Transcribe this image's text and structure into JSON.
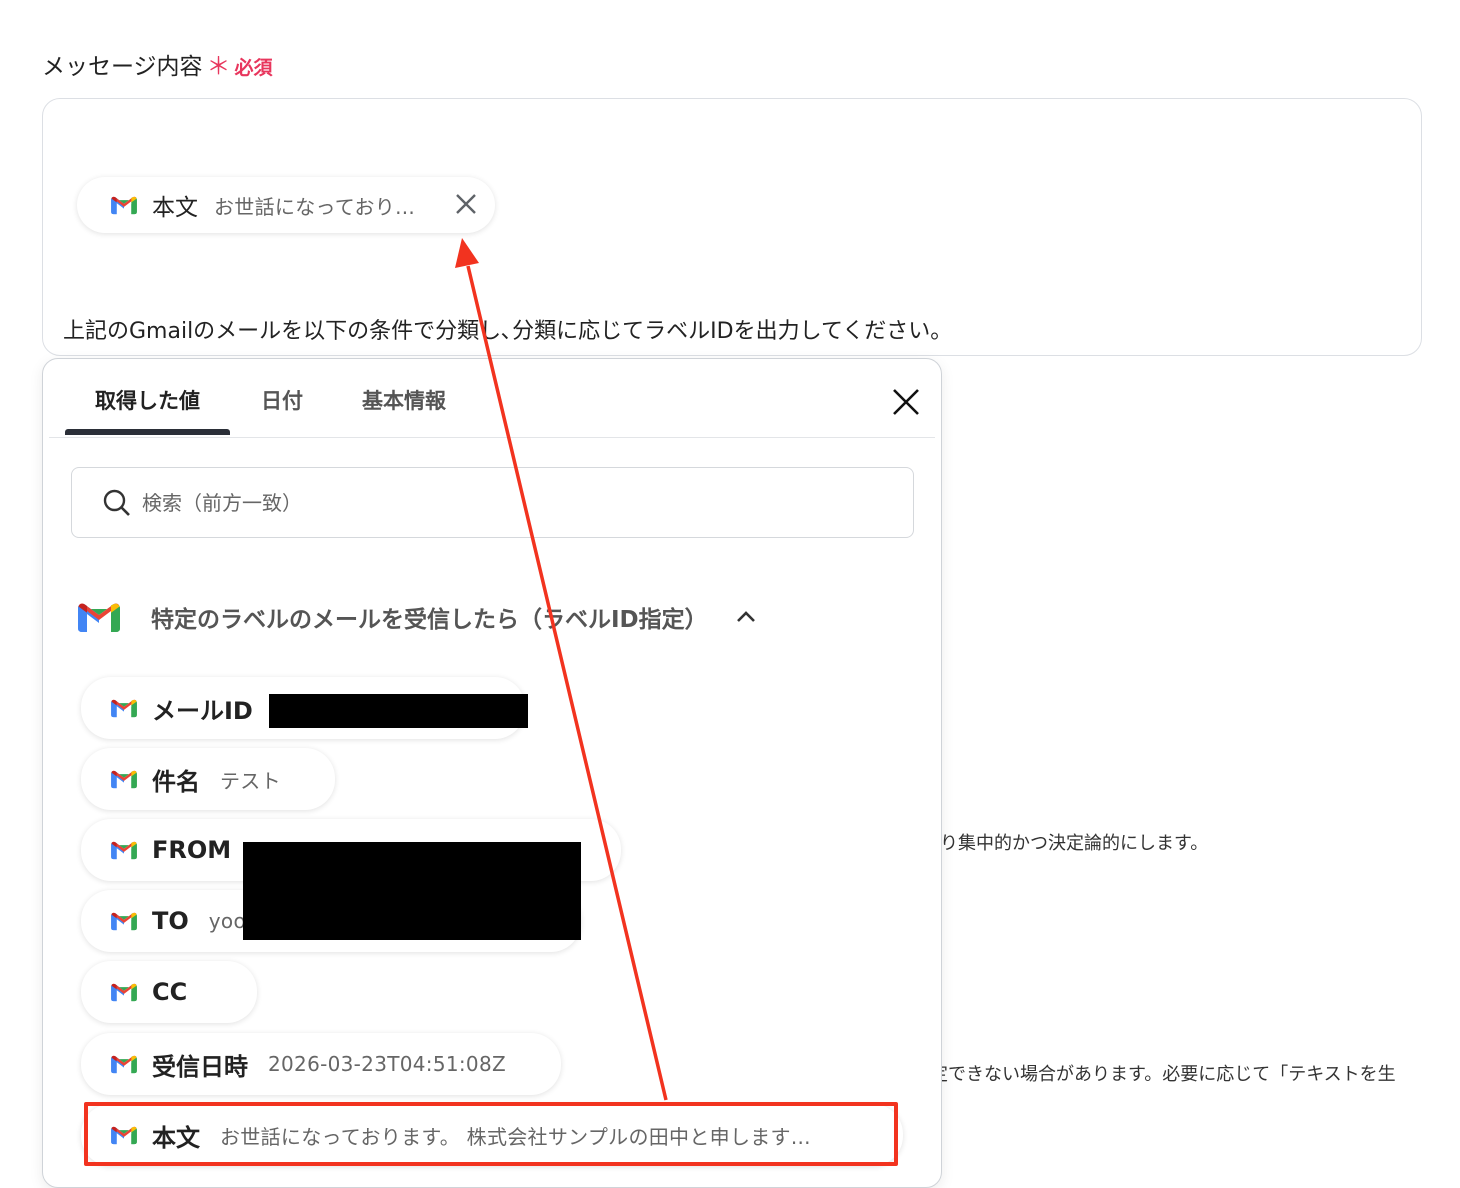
{
  "field": {
    "label": "メッセージ内容",
    "required_mark": "＊",
    "required_text": "必須"
  },
  "editor": {
    "chip": {
      "label": "本文",
      "value": "お世話になっており..."
    },
    "text": "上記のGmailのメールを以下の条件で分類し､分類に応じてラベルIDを出力してください。"
  },
  "background_hints": {
    "line1": "り集中的かつ決定論的にします。",
    "line2": "定できない場合があります。必要に応じて「テキストを生"
  },
  "popup": {
    "tabs": [
      {
        "label": "取得した値",
        "active": true
      },
      {
        "label": "日付",
        "active": false
      },
      {
        "label": "基本情報",
        "active": false
      }
    ],
    "search_placeholder": "検索（前方一致）",
    "group": {
      "title": "特定のラベルのメールを受信したら（ラベルID指定）",
      "expanded": true
    },
    "items": [
      {
        "label": "メールID",
        "value": ""
      },
      {
        "label": "件名",
        "value": "テスト"
      },
      {
        "label": "FROM",
        "value": ""
      },
      {
        "label": "TO",
        "value": "yoo"
      },
      {
        "label": "CC",
        "value": ""
      },
      {
        "label": "受信日時",
        "value": "2026-03-23T04:51:08Z"
      },
      {
        "label": "本文",
        "value": "お世話になっております。 株式会社サンプルの田中と申します..."
      }
    ]
  },
  "colors": {
    "required": "#e8365d",
    "annotation": "#f2331f",
    "gmail_red": "#ea4335",
    "gmail_blue": "#4285f4",
    "gmail_green": "#34a853",
    "gmail_yellow": "#fbbc05"
  },
  "icons": [
    "gmail-icon",
    "close-icon",
    "search-icon",
    "chevron-up-icon"
  ]
}
